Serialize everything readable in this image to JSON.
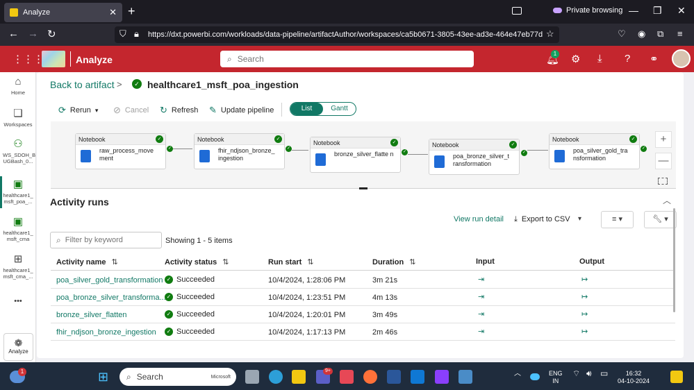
{
  "browser": {
    "tab_title": "Analyze",
    "tab_close": "✕",
    "new_tab": "+",
    "private_label": "Private browsing",
    "url": "https://dxt.powerbi.com/workloads/data-pipeline/artifactAuthor/workspaces/ca5b0671-3805-43ee-ad3e-464e47eb77d"
  },
  "app": {
    "title": "Analyze",
    "search_placeholder": "Search",
    "notification_count": "1"
  },
  "rail": {
    "items": [
      {
        "label": "Home"
      },
      {
        "label": "Workspaces"
      },
      {
        "label": "WS_SDOH_B UGBash_0..."
      },
      {
        "label": "healthcare1_ msft_poa_..."
      },
      {
        "label": "healthcare1_ msft_cma"
      },
      {
        "label": "healthcare1_ msft_cma_..."
      }
    ],
    "more": "•••",
    "bottom_label": "Analyze"
  },
  "breadcrumb": {
    "back": "Back to artifact",
    "separator": ">",
    "pipeline_name": "healthcare1_msft_poa_ingestion"
  },
  "toolbar": {
    "rerun": "Rerun",
    "cancel": "Cancel",
    "refresh": "Refresh",
    "update": "Update pipeline",
    "view_list": "List",
    "view_gantt": "Gantt"
  },
  "pipeline": {
    "nodes": [
      {
        "type": "Notebook",
        "name": "raw_process_move ment"
      },
      {
        "type": "Notebook",
        "name": "fhir_ndjson_bronze_ ingestion"
      },
      {
        "type": "Notebook",
        "name": "bronze_silver_flatte n"
      },
      {
        "type": "Notebook",
        "name": "poa_bronze_silver_t ransformation"
      },
      {
        "type": "Notebook",
        "name": "poa_silver_gold_tra nsformation"
      }
    ],
    "zoom_in": "+",
    "zoom_out": "—"
  },
  "activity": {
    "title": "Activity runs",
    "view_run_detail": "View run detail",
    "export": "Export to CSV",
    "filter_placeholder": "Filter by keyword",
    "showing": "Showing 1 - 5 items",
    "columns": {
      "name": "Activity name",
      "status": "Activity status",
      "start": "Run start",
      "duration": "Duration",
      "input": "Input",
      "output": "Output"
    },
    "rows": [
      {
        "name": "poa_silver_gold_transformation",
        "status": "Succeeded",
        "start": "10/4/2024, 1:28:06 PM",
        "duration": "3m 21s"
      },
      {
        "name": "poa_bronze_silver_transforma...",
        "status": "Succeeded",
        "start": "10/4/2024, 1:23:51 PM",
        "duration": "4m 13s"
      },
      {
        "name": "bronze_silver_flatten",
        "status": "Succeeded",
        "start": "10/4/2024, 1:20:01 PM",
        "duration": "3m 49s"
      },
      {
        "name": "fhir_ndjson_bronze_ingestion",
        "status": "Succeeded",
        "start": "10/4/2024, 1:17:13 PM",
        "duration": "2m 46s"
      }
    ]
  },
  "taskbar": {
    "search": "Search",
    "search_brand": "Microsoft",
    "lang": "ENG",
    "region": "IN",
    "time": "16:32",
    "date": "04-10-2024",
    "weather_badge": "1",
    "teams_badge": "9+"
  },
  "colors": {
    "app_header": "#c4262e",
    "accent": "#117865",
    "success": "#107c10"
  }
}
